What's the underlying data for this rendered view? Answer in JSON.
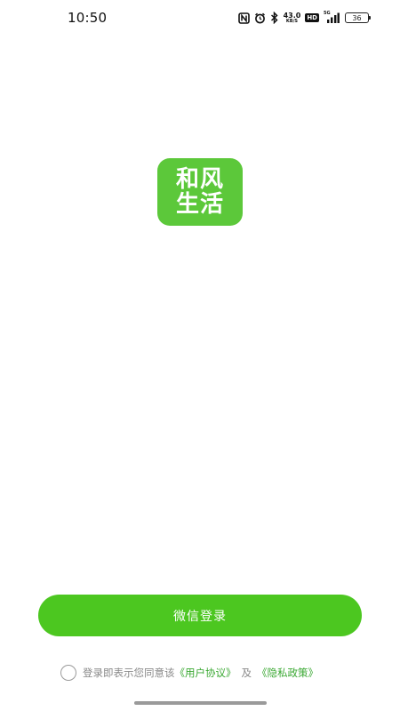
{
  "status_bar": {
    "time": "10:50",
    "net_speed_value": "43.0",
    "net_speed_unit": "KB/S",
    "hd_badge": "HD",
    "signal_label": "5G",
    "battery_level": "36",
    "icons": [
      "nfc-icon",
      "alarm-icon",
      "bluetooth-icon",
      "signal-icon",
      "battery-icon"
    ]
  },
  "app": {
    "logo_line1": "和风",
    "logo_line2": "生活",
    "brand_color": "#5cc83a"
  },
  "login": {
    "wechat_button_label": "微信登录",
    "button_color": "#4cc720"
  },
  "agreement": {
    "checked": false,
    "prefix_text": "登录即表示您同意该",
    "user_agreement_link": "《用户协议》",
    "separator": "及",
    "privacy_policy_link": "《隐私政策》",
    "link_color": "#3aa832"
  }
}
